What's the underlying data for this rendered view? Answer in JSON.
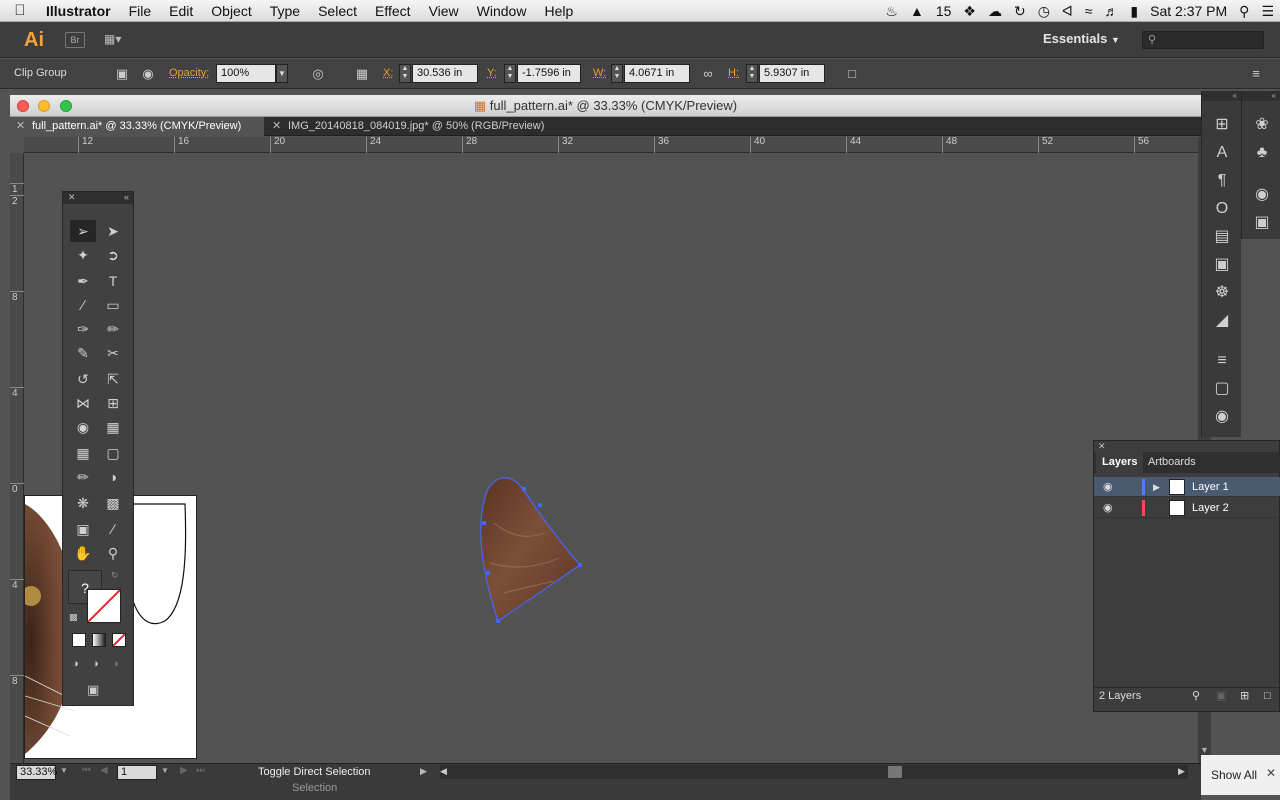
{
  "menubar": {
    "app": "Illustrator",
    "menus": [
      "File",
      "Edit",
      "Object",
      "Type",
      "Select",
      "Effect",
      "View",
      "Window",
      "Help"
    ],
    "adobe_badge": "15",
    "clock": "Sat 2:37 PM"
  },
  "appbar": {
    "logo": "Ai",
    "bridge": "Br",
    "workspace": "Essentials"
  },
  "control": {
    "selection_type": "Clip Group",
    "opacity_label": "Opacity:",
    "opacity_value": "100%",
    "x_label": "X:",
    "x_value": "30.536 in",
    "y_label": "Y:",
    "y_value": "-1.7596 in",
    "w_label": "W:",
    "w_value": "4.0671 in",
    "h_label": "H:",
    "h_value": "5.9307 in"
  },
  "document": {
    "title": "full_pattern.ai* @ 33.33% (CMYK/Preview)",
    "tabs": [
      {
        "label": "full_pattern.ai* @ 33.33% (CMYK/Preview)"
      },
      {
        "label": "IMG_20140818_084019.jpg* @ 50% (RGB/Preview)"
      }
    ],
    "hruler_ticks": [
      "12",
      "16",
      "20",
      "24",
      "28",
      "32",
      "36",
      "40",
      "44",
      "48",
      "52",
      "56"
    ],
    "vruler_ticks": [
      "1",
      "2",
      "8",
      "4",
      "0",
      "4",
      "8"
    ]
  },
  "status": {
    "zoom": "33.33%",
    "artboard": "1",
    "tool_hint": "Toggle Direct Selection",
    "tool_name": "Selection"
  },
  "layers": {
    "tabs": [
      "Layers",
      "Artboards"
    ],
    "rows": [
      {
        "name": "Layer 1",
        "color": "#4f7cff"
      },
      {
        "name": "Layer 2",
        "color": "#ff4a4a"
      }
    ],
    "count": "2 Layers"
  },
  "tools_panel": {
    "unknown_glyph": "?"
  },
  "notification": {
    "show_all": "Show All"
  },
  "colors": {
    "accent_orange": "#e8a030",
    "selection_blue": "#4466ff"
  }
}
